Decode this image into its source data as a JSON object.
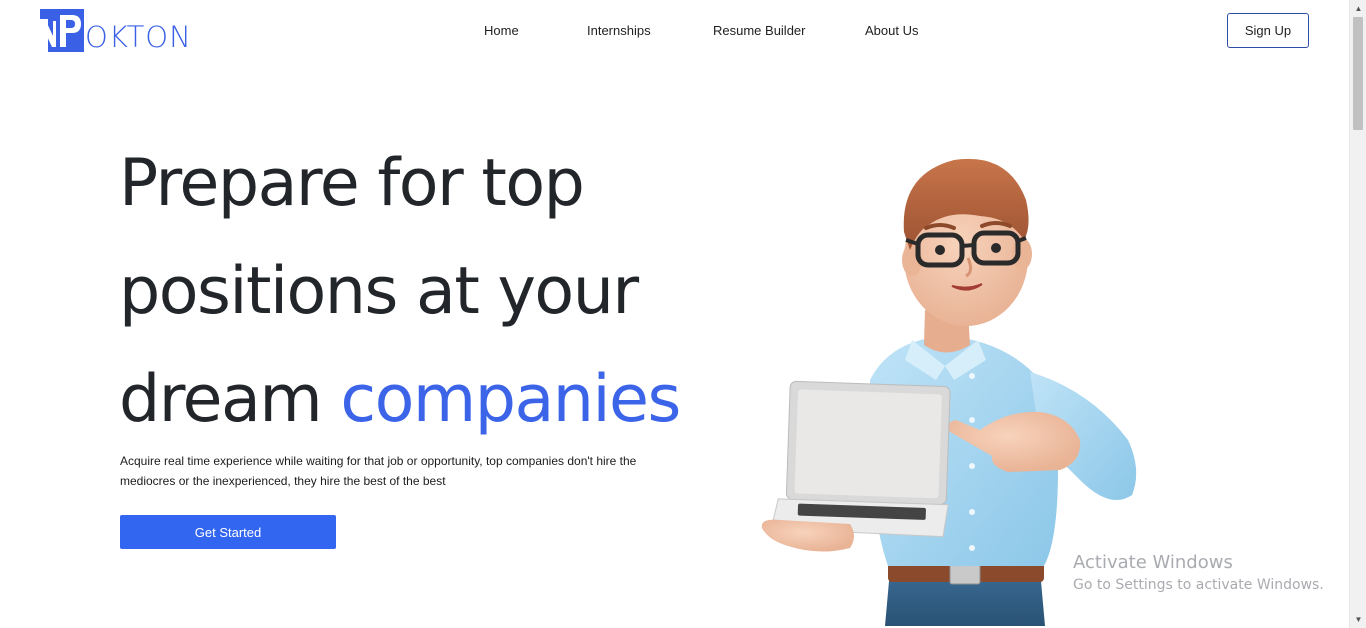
{
  "brand": {
    "name": "OKTON",
    "mark_letters": "NP",
    "color": "#3a60e6"
  },
  "nav": {
    "items": [
      {
        "label": "Home"
      },
      {
        "label": "Internships"
      },
      {
        "label": "Resume Builder"
      },
      {
        "label": "About Us"
      }
    ],
    "signup_label": "Sign Up"
  },
  "hero": {
    "headline_line1": "Prepare for top",
    "headline_line2": "positions at your",
    "headline_line3_plain": "dream",
    "headline_line3_accent": "companies",
    "accent_color": "#3c64e8",
    "subtext": "Acquire real time experience while waiting for that job or opportunity, top companies don't hire the mediocres or the inexperienced, they hire the best of the best",
    "cta_label": "Get Started",
    "cta_color": "#3366f0"
  },
  "watermark": {
    "title": "Activate Windows",
    "subtitle": "Go to Settings to activate Windows."
  }
}
